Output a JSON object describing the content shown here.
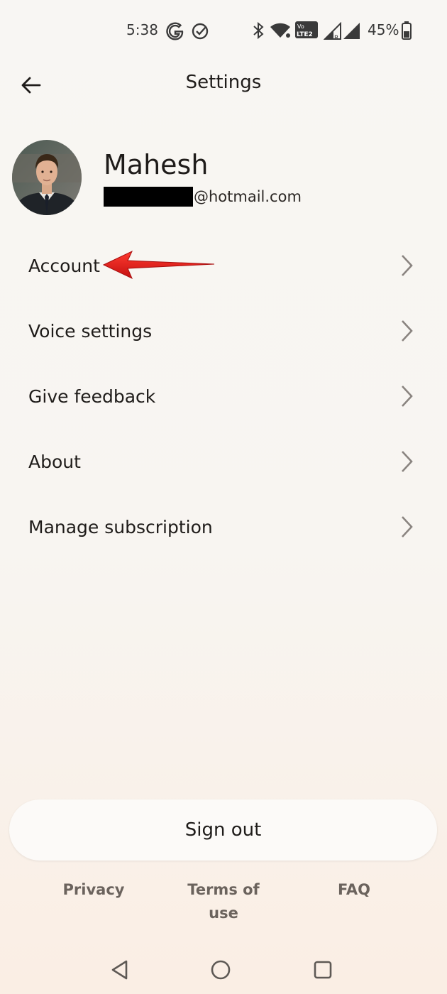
{
  "status_bar": {
    "time": "5:38",
    "battery": "45%",
    "icons": [
      "google-icon",
      "check-circle-icon",
      "bluetooth-icon",
      "wifi-icon",
      "volte-icon",
      "signal-icon",
      "signal-roaming-icon",
      "battery-icon"
    ],
    "volte_text": "Vo LTE2",
    "roaming_text": "R"
  },
  "header": {
    "title": "Settings",
    "back_icon": "arrow-left-icon"
  },
  "profile": {
    "name": "Mahesh",
    "email_suffix": "@hotmail.com"
  },
  "menu": {
    "items": [
      {
        "label": "Account"
      },
      {
        "label": "Voice settings"
      },
      {
        "label": "Give feedback"
      },
      {
        "label": "About"
      },
      {
        "label": "Manage subscription"
      }
    ],
    "chevron_icon": "chevron-right-icon"
  },
  "annotation": {
    "icon": "red-arrow-icon",
    "color": "#e01a1a"
  },
  "actions": {
    "sign_out": "Sign out"
  },
  "footer": {
    "privacy": "Privacy",
    "terms": "Terms of use",
    "faq": "FAQ"
  },
  "nav_bar": {
    "icons": [
      "back-triangle-icon",
      "home-circle-icon",
      "recents-square-icon"
    ]
  },
  "colors": {
    "background_top": "#f8f6f3",
    "background_bottom": "#faeee4",
    "text": "#1f1c1a",
    "footer_link": "#6b635d",
    "chevron": "#8a8480"
  }
}
